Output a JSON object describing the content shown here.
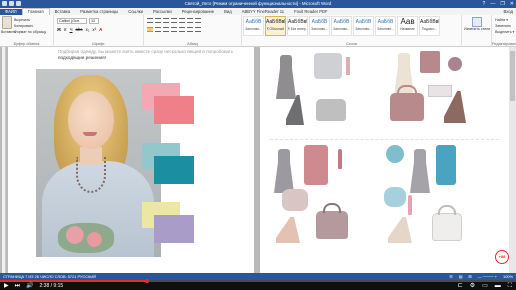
{
  "window": {
    "title": "Cвятой_Лето [Режим ограниченной функциональности] - Microsoft Word",
    "controls": [
      "?",
      "—",
      "❐",
      "✕"
    ]
  },
  "tabs": [
    "ФАЙЛ",
    "Главная",
    "Вставка",
    "Разметка страницы",
    "Ссылки",
    "Рассылки",
    "Рецензирование",
    "Вид",
    "ABBYY FineReader 11",
    "Foxit Reader PDF"
  ],
  "tabs_right": [
    "Вход"
  ],
  "ribbon": {
    "clipboard": {
      "paste": "Вставить",
      "items": [
        "Вырезать",
        "Копировать",
        "Формат по образцу"
      ],
      "label": "Буфер обмена"
    },
    "font": {
      "name": "Calibri (Осн.",
      "size": "12",
      "format_buttons": [
        "Ж",
        "К",
        "Ч",
        "abc",
        "x₂",
        "x²"
      ],
      "label": "Шрифт"
    },
    "paragraph": {
      "label": "Абзац"
    },
    "styles": {
      "items": [
        {
          "preview": "АаБбВ",
          "name": "Заголово...",
          "kind": "h"
        },
        {
          "preview": "АаБбВвГ",
          "name": "¶ Обычный",
          "kind": "n",
          "selected": true
        },
        {
          "preview": "АаБбВвГ",
          "name": "¶ Без интер...",
          "kind": "n"
        },
        {
          "preview": "АаБбВ",
          "name": "Заголово...",
          "kind": "h"
        },
        {
          "preview": "АаБбВ",
          "name": "Заголово...",
          "kind": "h"
        },
        {
          "preview": "АаБбВ",
          "name": "Заголово...",
          "kind": "h"
        },
        {
          "preview": "АаБбВ",
          "name": "Заголово...",
          "kind": "h"
        },
        {
          "preview": "Аав",
          "name": "Название",
          "kind": "big"
        },
        {
          "preview": "АаБбВвГ",
          "name": "Подзаго...",
          "kind": "n"
        }
      ],
      "change": "Изменить стили",
      "label": "Стили"
    },
    "editing": {
      "items": [
        "Найти ▾",
        "Заменить",
        "Выделить ▾"
      ],
      "label": "Редактирование"
    }
  },
  "document": {
    "page1_text_faint": "Подбирая одежду, вы можете взять вместе сразу несколько вещей и попробовать",
    "page1_text": "подходящие решения!"
  },
  "swatches": [
    {
      "group": "light-pink",
      "color": "#f4a9b2"
    },
    {
      "group": "coral-pink",
      "color": "#ef7f88"
    },
    {
      "group": "light-teal",
      "color": "#92c7cd"
    },
    {
      "group": "teal",
      "color": "#1b8fa1"
    },
    {
      "group": "light-yellow",
      "color": "#ece7a2"
    },
    {
      "group": "lavender",
      "color": "#a99cc9"
    }
  ],
  "statusbar": {
    "left": "СТРАНИЦА 7 ИЗ 26    ЧИСЛО СЛОВ: 5721    РУССКИЙ",
    "right": [
      "☰",
      "▤",
      "⊞",
      "— ──── +",
      "100%"
    ]
  },
  "player": {
    "current_time": "2:38",
    "duration": "9:15",
    "progress": 0.285,
    "icons": [
      "play-icon",
      "next-icon",
      "volume-icon",
      "captions-icon",
      "settings-icon",
      "miniplayer-icon",
      "theater-icon",
      "fullscreen-icon"
    ]
  },
  "badge": "+88"
}
